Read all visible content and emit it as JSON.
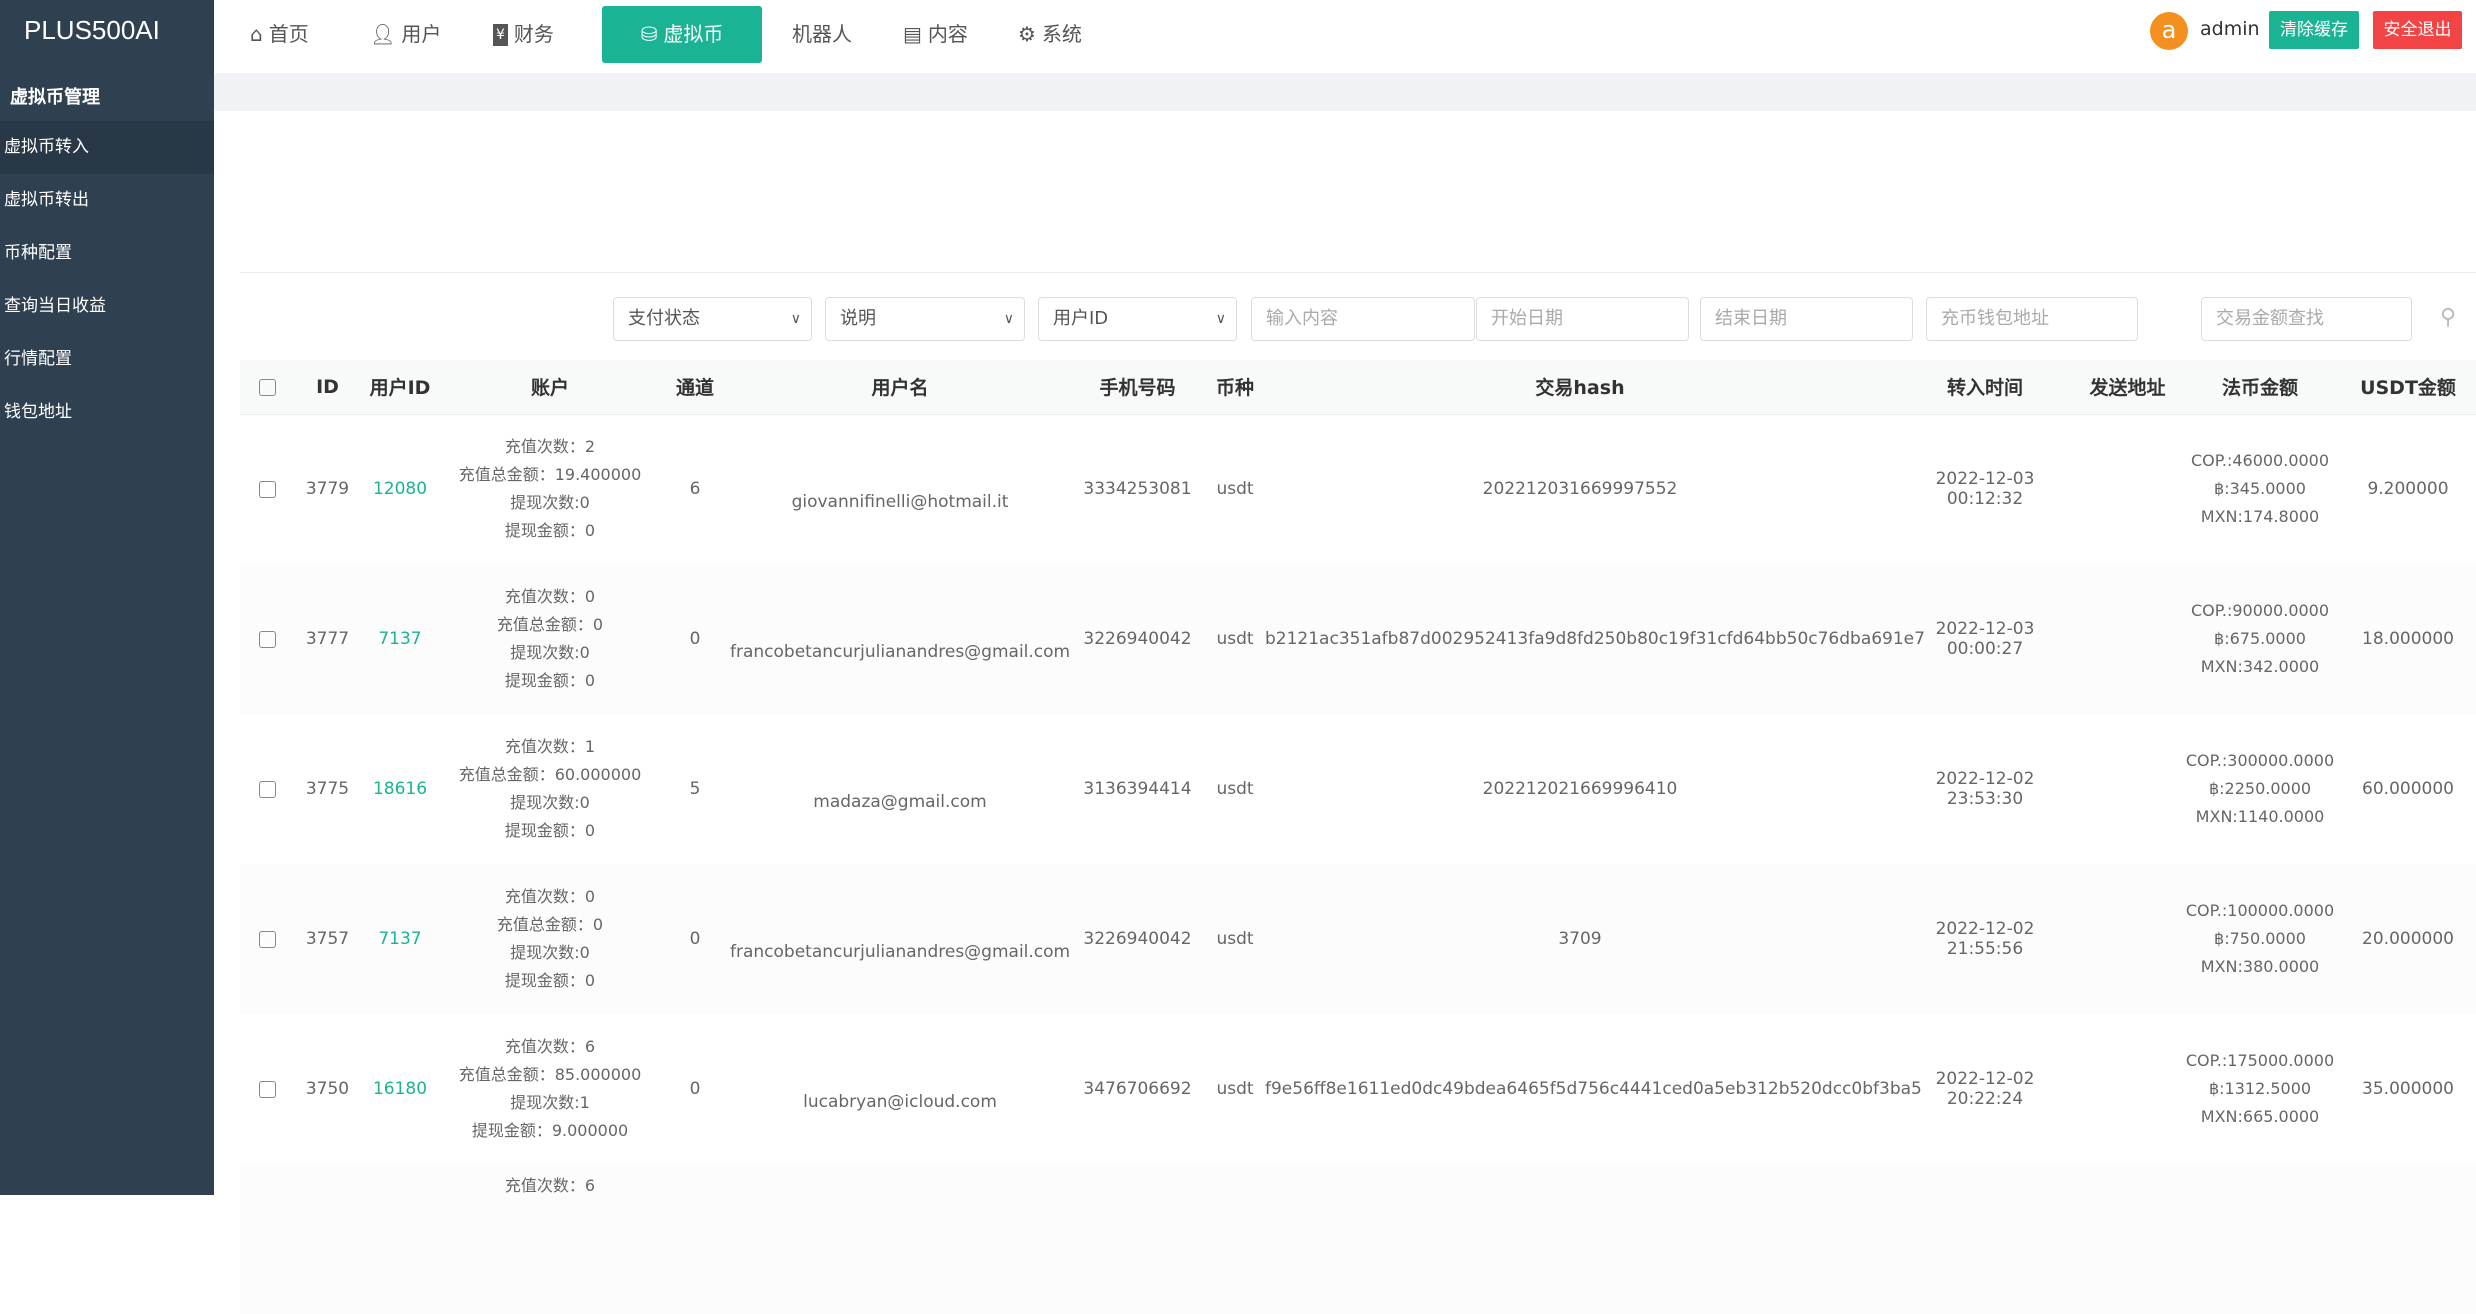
{
  "app": {
    "logo": "PLUS500AI"
  },
  "sidebar": {
    "heading": "虚拟币管理",
    "items": [
      {
        "label": "虚拟币转入",
        "active": true
      },
      {
        "label": "虚拟币转出"
      },
      {
        "label": "币种配置"
      },
      {
        "label": "查询当日收益"
      },
      {
        "label": "行情配置"
      },
      {
        "label": "钱包地址"
      }
    ]
  },
  "nav": {
    "items": [
      {
        "label": "首页",
        "icon": "home-icon"
      },
      {
        "label": "用户",
        "icon": "user-icon"
      },
      {
        "label": "财务",
        "icon": "yen-icon"
      },
      {
        "label": "虚拟币",
        "icon": "database-icon",
        "active": true
      },
      {
        "label": "机器人"
      },
      {
        "label": "内容",
        "icon": "document-icon"
      },
      {
        "label": "系统",
        "icon": "gear-icon"
      }
    ]
  },
  "user": {
    "avatar": "a",
    "name": "admin",
    "clear_cache": "清除缓存",
    "logout": "安全退出"
  },
  "colors": {
    "accent": "#1ab394",
    "danger": "#f24444",
    "sidebar": "#2f4050",
    "avatar": "#f39020"
  },
  "filters": {
    "pay_status": "支付状态",
    "note": "说明",
    "field": "用户ID",
    "content_ph": "输入内容",
    "start_ph": "开始日期",
    "end_ph": "结束日期",
    "wallet_ph": "充币钱包地址",
    "amount_ph": "交易金额查找"
  },
  "table": {
    "headers": [
      "ID",
      "用户ID",
      "账户",
      "通道",
      "用户名",
      "手机号码",
      "币种",
      "交易hash",
      "转入时间",
      "发送地址",
      "法币金额",
      "USDT金额"
    ],
    "account_labels": {
      "recharge_count": "充值次数：",
      "recharge_total": "充值总金额：",
      "withdraw_count": "提现次数:",
      "withdraw_amount": "提现金额："
    },
    "rows": [
      {
        "id": "3779",
        "uid": "12080",
        "rc": "2",
        "rt": "19.400000",
        "wc": "0",
        "wa": "0",
        "channel": "6",
        "username": "giovannifinelli@hotmail.it",
        "phone": "3334253081",
        "coin": "usdt",
        "hash": "202212031669997552",
        "time": "2022-12-03 00:12:32",
        "send": "",
        "cop": "COP.:46000.0000",
        "thb": "฿:345.0000",
        "mxn": "MXN:174.8000",
        "usdt": "9.200000"
      },
      {
        "id": "3777",
        "uid": "7137",
        "rc": "0",
        "rt": "0",
        "wc": "0",
        "wa": "0",
        "channel": "0",
        "username": "francobetancurjulianandres@gmail.com",
        "phone": "3226940042",
        "coin": "usdt",
        "hash": "b2121ac351afb87d002952413fa9d8fd250b80c19f31cfd64bb50c76dba691e7",
        "time": "2022-12-03 00:00:27",
        "send": "",
        "cop": "COP.:90000.0000",
        "thb": "฿:675.0000",
        "mxn": "MXN:342.0000",
        "usdt": "18.000000"
      },
      {
        "id": "3775",
        "uid": "18616",
        "rc": "1",
        "rt": "60.000000",
        "wc": "0",
        "wa": "0",
        "channel": "5",
        "username": "madaza@gmail.com",
        "phone": "3136394414",
        "coin": "usdt",
        "hash": "202212021669996410",
        "time": "2022-12-02 23:53:30",
        "send": "",
        "cop": "COP.:300000.0000",
        "thb": "฿:2250.0000",
        "mxn": "MXN:1140.0000",
        "usdt": "60.000000"
      },
      {
        "id": "3757",
        "uid": "7137",
        "rc": "0",
        "rt": "0",
        "wc": "0",
        "wa": "0",
        "channel": "0",
        "username": "francobetancurjulianandres@gmail.com",
        "phone": "3226940042",
        "coin": "usdt",
        "hash": "3709",
        "time": "2022-12-02 21:55:56",
        "send": "",
        "cop": "COP.:100000.0000",
        "thb": "฿:750.0000",
        "mxn": "MXN:380.0000",
        "usdt": "20.000000"
      },
      {
        "id": "3750",
        "uid": "16180",
        "rc": "6",
        "rt": "85.000000",
        "wc": "1",
        "wa": "9.000000",
        "channel": "0",
        "username": "lucabryan@icloud.com",
        "phone": "3476706692",
        "coin": "usdt",
        "hash": "f9e56ff8e1611ed0dc49bdea6465f5d756c4441ced0a5eb312b520dcc0bf3ba5",
        "time": "2022-12-02 20:22:24",
        "send": "",
        "cop": "COP.:175000.0000",
        "thb": "฿:1312.5000",
        "mxn": "MXN:665.0000",
        "usdt": "35.000000"
      }
    ],
    "partial_row": {
      "rc": "6"
    }
  }
}
